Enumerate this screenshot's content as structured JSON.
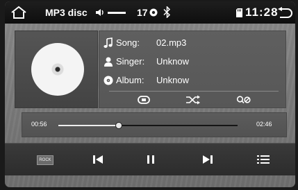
{
  "status": {
    "source": "MP3 disc",
    "volume": "17",
    "clock": "11:28"
  },
  "track": {
    "song_label": "Song:",
    "song_value": "02.mp3",
    "singer_label": "Singer:",
    "singer_value": "Unknow",
    "album_label": "Album:",
    "album_value": "Unknow"
  },
  "progress": {
    "elapsed": "00:56",
    "total": "02:46",
    "fraction": 0.337
  },
  "controls": {
    "eq_label": "ROCK"
  },
  "icons": [
    "home-icon",
    "volume-icon",
    "bluetooth-icon",
    "sd-card-icon",
    "back-icon",
    "music-note-icon",
    "person-icon",
    "album-icon",
    "repeat-icon",
    "shuffle-icon",
    "search-icon",
    "previous-icon",
    "pause-icon",
    "next-icon",
    "playlist-icon"
  ]
}
